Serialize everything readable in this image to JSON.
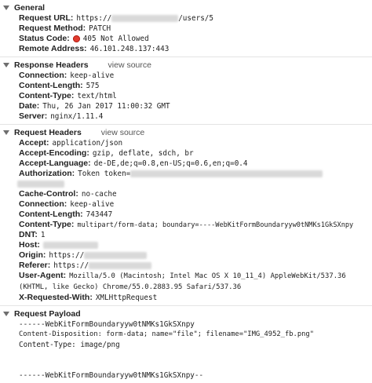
{
  "general": {
    "title": "General",
    "request_url_key": "Request URL:",
    "request_url_prefix": "https://",
    "request_url_suffix": "/users/5",
    "request_method_key": "Request Method:",
    "request_method": "PATCH",
    "status_code_key": "Status Code:",
    "status_code": "405 Not Allowed",
    "remote_address_key": "Remote Address:",
    "remote_address": "46.101.248.137:443"
  },
  "response_headers": {
    "title": "Response Headers",
    "view_source": "view source",
    "items": [
      {
        "key": "Connection:",
        "value": "keep-alive"
      },
      {
        "key": "Content-Length:",
        "value": "575"
      },
      {
        "key": "Content-Type:",
        "value": "text/html"
      },
      {
        "key": "Date:",
        "value": "Thu, 26 Jan 2017 11:00:32 GMT"
      },
      {
        "key": "Server:",
        "value": "nginx/1.11.4"
      }
    ]
  },
  "request_headers": {
    "title": "Request Headers",
    "view_source": "view source",
    "accept_key": "Accept:",
    "accept": "application/json",
    "accept_encoding_key": "Accept-Encoding:",
    "accept_encoding": "gzip, deflate, sdch, br",
    "accept_language_key": "Accept-Language:",
    "accept_language": "de-DE,de;q=0.8,en-US;q=0.6,en;q=0.4",
    "authorization_key": "Authorization:",
    "authorization_prefix": "Token token=",
    "cache_control_key": "Cache-Control:",
    "cache_control": "no-cache",
    "connection_key": "Connection:",
    "connection": "keep-alive",
    "content_length_key": "Content-Length:",
    "content_length": "743447",
    "content_type_key": "Content-Type:",
    "content_type": "multipart/form-data; boundary=----WebKitFormBoundaryyw0tNMKs1GkSXnpy",
    "dnt_key": "DNT:",
    "dnt": "1",
    "host_key": "Host:",
    "origin_key": "Origin:",
    "origin_prefix": "https://",
    "referer_key": "Referer:",
    "referer_prefix": "https://",
    "user_agent_key": "User-Agent:",
    "user_agent": "Mozilla/5.0 (Macintosh; Intel Mac OS X 10_11_4) AppleWebKit/537.36 (KHTML, like Gecko) Chrome/55.0.2883.95 Safari/537.36",
    "x_requested_with_key": "X-Requested-With:",
    "x_requested_with": "XMLHttpRequest"
  },
  "payload": {
    "title": "Request Payload",
    "lines": [
      "------WebKitFormBoundaryyw0tNMKs1GkSXnpy",
      "Content-Disposition: form-data; name=\"file\"; filename=\"IMG_4952_fb.png\"",
      "Content-Type: image/png",
      "",
      "",
      "------WebKitFormBoundaryyw0tNMKs1GkSXnpy--"
    ]
  }
}
